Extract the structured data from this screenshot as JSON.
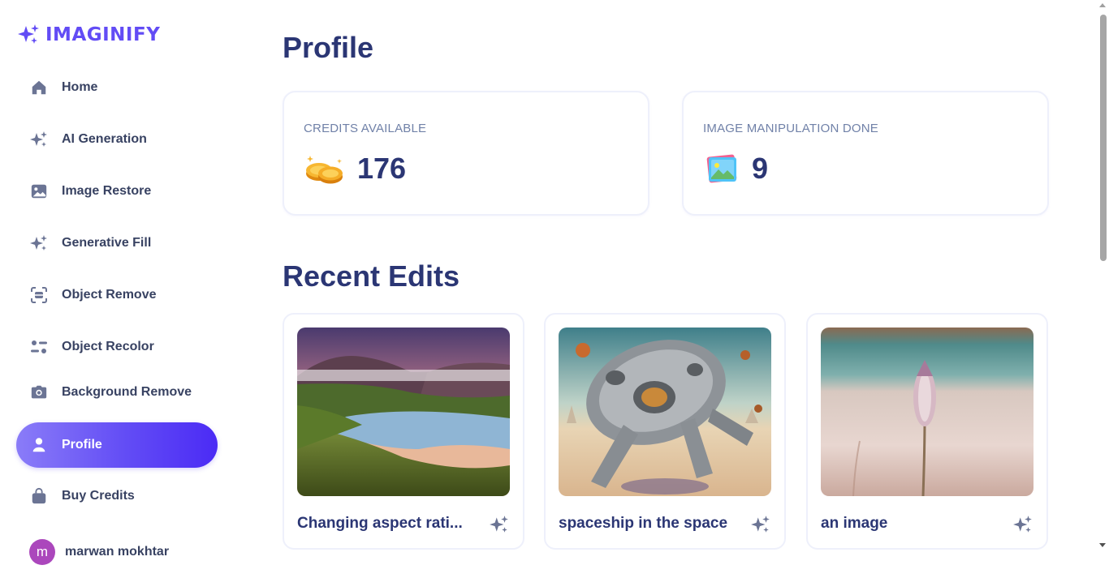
{
  "app": {
    "logo_text": "IMAGINIFY"
  },
  "sidebar": {
    "items": [
      {
        "label": "Home",
        "icon": "home-icon"
      },
      {
        "label": "AI Generation",
        "icon": "sparkles-icon"
      },
      {
        "label": "Image Restore",
        "icon": "image-icon"
      },
      {
        "label": "Generative Fill",
        "icon": "sparkles-icon"
      },
      {
        "label": "Object Remove",
        "icon": "scan-icon"
      },
      {
        "label": "Object Recolor",
        "icon": "filter-icon"
      },
      {
        "label": "Background Remove",
        "icon": "camera-icon"
      },
      {
        "label": "Profile",
        "icon": "user-icon",
        "active": true
      },
      {
        "label": "Buy Credits",
        "icon": "bag-icon"
      }
    ],
    "user": {
      "initial": "m",
      "name": "marwan mokhtar"
    }
  },
  "main": {
    "title": "Profile",
    "stats": [
      {
        "label": "CREDITS AVAILABLE",
        "value": "176",
        "icon": "coins-icon"
      },
      {
        "label": "IMAGE MANIPULATION DONE",
        "value": "9",
        "icon": "photo-icon"
      }
    ],
    "recent_title": "Recent Edits",
    "recent": [
      {
        "title": "Changing aspect rati...",
        "icon": "sparkles-icon"
      },
      {
        "title": "spaceship in the space",
        "icon": "sparkles-icon"
      },
      {
        "title": "an image",
        "icon": "sparkles-icon"
      }
    ]
  },
  "colors": {
    "accent": "#624cf5",
    "heading": "#2b3674",
    "text": "#384262",
    "muted": "#7081a8"
  }
}
